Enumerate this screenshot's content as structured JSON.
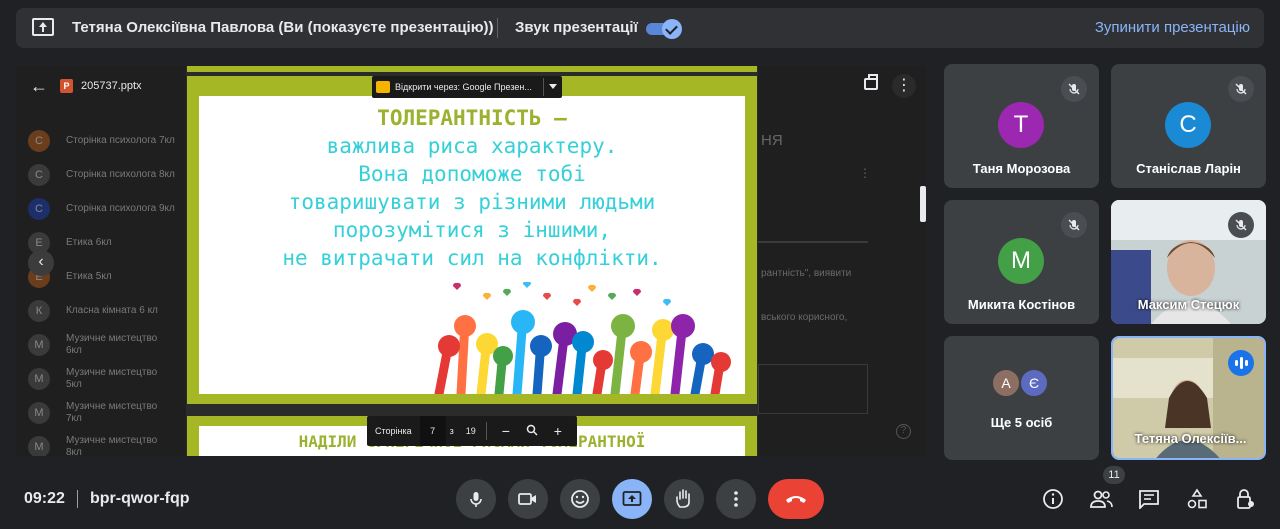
{
  "topbar": {
    "presenter": "Тетяна Олексіївна Павлова (Ви (показуєте презентацію))",
    "sound_label": "Звук презентації",
    "sound_on": true,
    "stop_label": "Зупинити презентацію"
  },
  "viewer": {
    "file_name": "205737.pptx",
    "open_with": "Відкрити через: Google Презен...",
    "pager": {
      "label": "Сторінка",
      "current": "7",
      "of": "з",
      "total": "19"
    }
  },
  "background_list": [
    {
      "letter": "С",
      "text": "Сторінка психолога 7кл"
    },
    {
      "letter": "С",
      "text": "Сторінка психолога 8кл"
    },
    {
      "letter": "С",
      "text": "Сторінка психолога 9кл"
    },
    {
      "letter": "Е",
      "text": "Етика 6кл"
    },
    {
      "letter": "Е",
      "text": "Етика 5кл"
    },
    {
      "letter": "К",
      "text": "Класна кімната 6 кл"
    },
    {
      "letter": "М",
      "text": "Музичне мистецтво",
      "sub": "6кл"
    },
    {
      "letter": "М",
      "text": "Музичне мистецтво",
      "sub": "5кл"
    },
    {
      "letter": "М",
      "text": "Музичне мистецтво",
      "sub": "7кл"
    },
    {
      "letter": "М",
      "text": "Музичне мистецтво",
      "sub": "8кл"
    }
  ],
  "background_right": {
    "heading_fragment": "НЯ",
    "line1": "рантність\", виявити",
    "line2": "вського корисного,"
  },
  "slide": {
    "title": "ТОЛЕРАНТНІСТЬ –",
    "lines": [
      "важлива риса характеру.",
      "Вона допоможе тобі",
      "товаришувати з різними людьми",
      "порозумітися з іншими,",
      "не витрачати сил на конфлікти."
    ],
    "next_title": "НАДІЛИ СУПЕРЕЧНОЇ РИСАМИ ТОЛЕРАНТНОЇ"
  },
  "participants": [
    {
      "name": "Таня Морозова",
      "initial": "Т",
      "color": "#9c27b0",
      "muted": true
    },
    {
      "name": "Станіслав Ларін",
      "initial": "С",
      "color": "#1a8ad4",
      "muted": true
    },
    {
      "name": "Микита Костінов",
      "initial": "М",
      "color": "#43a047",
      "muted": true
    },
    {
      "name": "Максим Стецюк",
      "initial": "",
      "color": "#9aa5a8",
      "muted": true,
      "video": true
    },
    {
      "name": "Ще 5 осіб",
      "mini": [
        {
          "initial": "А",
          "color": "#8d6e63"
        },
        {
          "initial": "Є",
          "color": "#5c6bc0"
        }
      ]
    },
    {
      "name": "Тетяна Олексіїв...",
      "video": true,
      "speaking": true
    }
  ],
  "bottom": {
    "time": "09:22",
    "meeting_code": "bpr-qwor-fqp",
    "people_count": "11"
  },
  "colors": {
    "accent": "#8ab4f8",
    "end_call": "#ea4335",
    "slide_border": "#a6b726",
    "slide_title": "#9ab230",
    "slide_text": "#35d0d8"
  }
}
